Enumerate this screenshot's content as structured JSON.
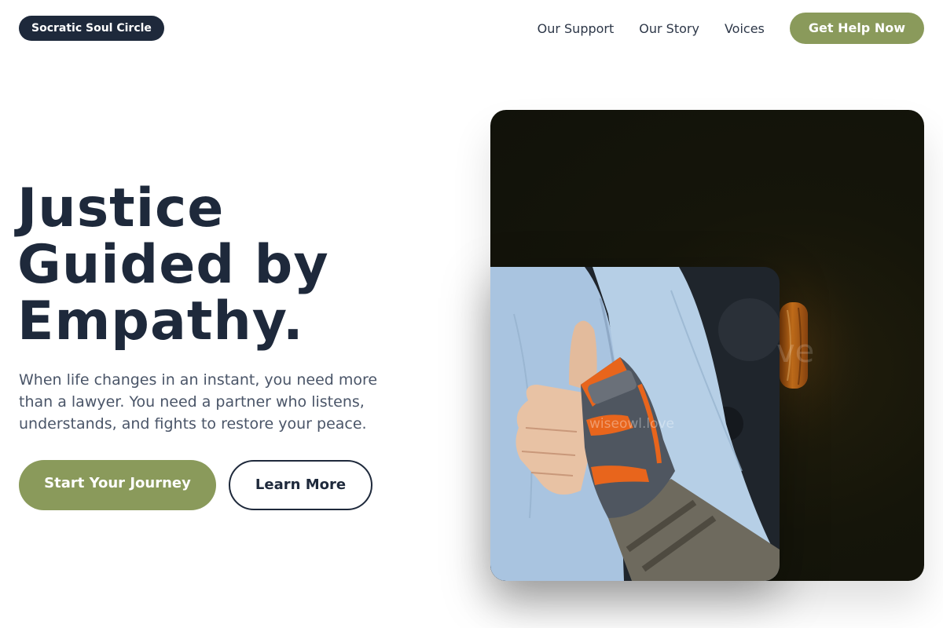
{
  "header": {
    "logo": "Socratic Soul Circle",
    "nav": [
      "Our Support",
      "Our Story",
      "Voices"
    ],
    "cta": "Get Help Now"
  },
  "hero": {
    "title_lines": [
      "Justice",
      "Guided by",
      "Empathy."
    ],
    "subtitle_lines": [
      "When life changes in an instant, you need more",
      "than a lawyer. You need a partner who listens,",
      "understands, and fights to restore your peace."
    ],
    "primary_button": "Start Your Journey",
    "secondary_button": "Learn More"
  },
  "media": {
    "watermark": "wiseowl.love",
    "watermark_partial": "ve",
    "photo_subject": "hand-with-wrist-brace-thumbs-up"
  },
  "colors": {
    "navy": "#1e293b",
    "olive": "#8a9a5b",
    "text_muted": "#4a5568",
    "brace_orange": "#e8651c",
    "denim": "#a9c4e0"
  }
}
